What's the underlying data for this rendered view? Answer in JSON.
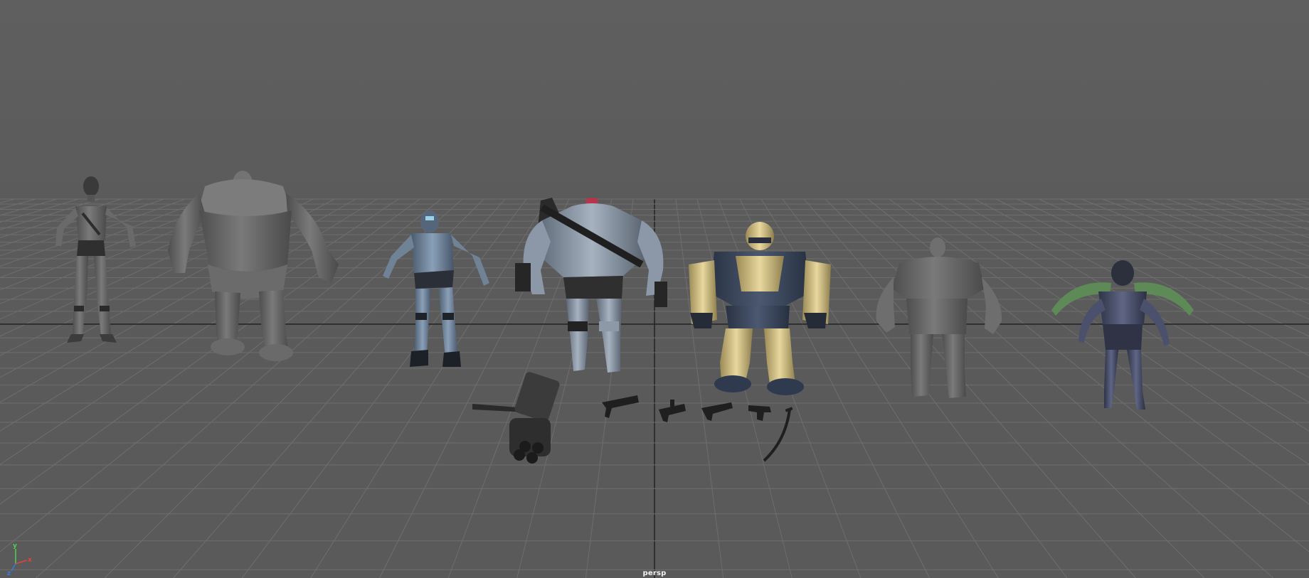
{
  "viewport": {
    "camera_label": "persp",
    "background_color": "#5d5d5d",
    "grid_color": "#6e6e6e",
    "grid_axis_color": "#262626"
  },
  "axis_gizmo": {
    "x_label": "x",
    "y_label": "y",
    "z_label": "z",
    "x_color": "#e0453c",
    "y_color": "#4fd14f",
    "z_color": "#3c78e0"
  },
  "models": [
    {
      "name": "rigged-female-character",
      "color": "#8c8c8c"
    },
    {
      "name": "large-brute-blockout",
      "color": "#727272"
    },
    {
      "name": "robot-soldier",
      "color": "#7f95ad"
    },
    {
      "name": "heavy-gunner-character",
      "color": "#94a2b3"
    },
    {
      "name": "gold-armored-mech",
      "color": "#d8c68a"
    },
    {
      "name": "brute-blockout",
      "color": "#7a7a7a"
    },
    {
      "name": "multi-armed-creature",
      "color": "#4a4f66"
    }
  ],
  "props": [
    {
      "name": "minigun"
    },
    {
      "name": "assault-rifle"
    },
    {
      "name": "rifle"
    },
    {
      "name": "smg"
    },
    {
      "name": "pistol"
    },
    {
      "name": "katana"
    }
  ]
}
